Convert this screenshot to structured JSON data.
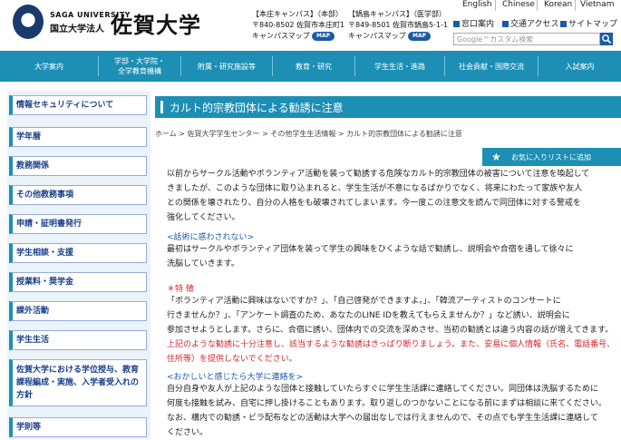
{
  "header": {
    "logo_en": "SAGA UNIVERSITY",
    "logo_jp_small": "国立大学法人",
    "logo_jp_large": "佐賀大学",
    "campus1": {
      "label": "【本庄キャンパス】（本部）",
      "address": "〒840-8502 佐賀市本庄町1",
      "map_label": "キャンパスマップ"
    },
    "campus2": {
      "label": "【鍋島キャンパス】（医学部）",
      "address": "〒849-8501 佐賀市鍋島5-1-1",
      "map_label": "キャンパスマップ"
    },
    "map_button": "MAP",
    "languages": [
      "English",
      "Chinese",
      "Korean",
      "Vietnam"
    ],
    "top_links": [
      "窓口案内",
      "交通アクセス",
      "サイトマップ"
    ],
    "search_placeholder": "Google™カスタム検索"
  },
  "nav": [
    "大学案内",
    "学部・大学院・全学教育機構",
    "附属・研究施設等",
    "教育・研究",
    "学生生活・進路",
    "社会貢献・国際交流",
    "入試案内"
  ],
  "sidebar": [
    "情報セキュリティについて",
    "学年暦",
    "教務関係",
    "その他教務事項",
    "申請・証明書発行",
    "学生相談・支援",
    "授業料・奨学金",
    "課外活動",
    "学生生活",
    "佐賀大学における学位授与、教育課程編成・実施、入学者受入れの方針",
    "学則等"
  ],
  "page": {
    "title": "カルト的宗教団体による勧誘に注意",
    "breadcrumb": "ホーム > 佐賀大学学生センター > その他学生生活情報 > カルト的宗教団体による勧誘に注意",
    "favorite_button": "お気に入りリストに追加",
    "intro": [
      "以前からサークル活動やボランティア活動を装って勧誘する危険なカルト的宗教団体の被害について注意を喚起して",
      "きましたが、このような団体に取り込まれると、学生生活が不意になるばかりでなく、将来にわたって家族や友人",
      "との関係を壊されたり、自分の人格をも破壊されてしまいます。今一度この注意文を読んで同団体に対する警戒を",
      "強化してください。"
    ],
    "section1_head": "<話術に惑わされない>",
    "section1": [
      "最初はサークルやボランティア団体を装って学生の興味をひくような話で勧誘し、説明会や合宿を通して徐々に",
      "洗脳していきます。"
    ],
    "section2_head": "＊特 徴",
    "section2": [
      "「ボランティア活動に興味はないですか？」、「自己啓発ができますよ。」、「韓流アーティストのコンサートに",
      "行きませんか？」、「アンケート調査のため、あなたのLINE IDを教えてもらえませんか？」など誘い、説明会に",
      "参加させようとします。さらに、合宿に誘い、団体内での交流を深めさせ、当初の勧誘とは違う内容の話が増えてきます。"
    ],
    "section2_warn": [
      "上記のような勧誘に十分注意し、該当するような勧誘はきっぱり断りましょう。また、安易に個人情報（氏名、電話番号、",
      "住所等）を提供しないでください。"
    ],
    "section3_head": "<おかしいと感じたら大学に連絡を>",
    "section3": [
      "自分自身や友人が上記のような団体と接触していたらすぐに学生生活課に連絡してください。同団体は洗脳するために",
      "何度も接触を試み、自宅に押し掛けることもあります。取り返しのつかないことになる前にまずは相談に来てください。",
      "なお、構内での勧誘・ビラ配布などの活動は大学への届出なしでは行えませんので、その点でも学生生活課に連絡して",
      "ください。"
    ]
  },
  "colors": {
    "accent": "#1d8fb5",
    "link": "#1d5aa8",
    "warn": "#d0262c"
  }
}
